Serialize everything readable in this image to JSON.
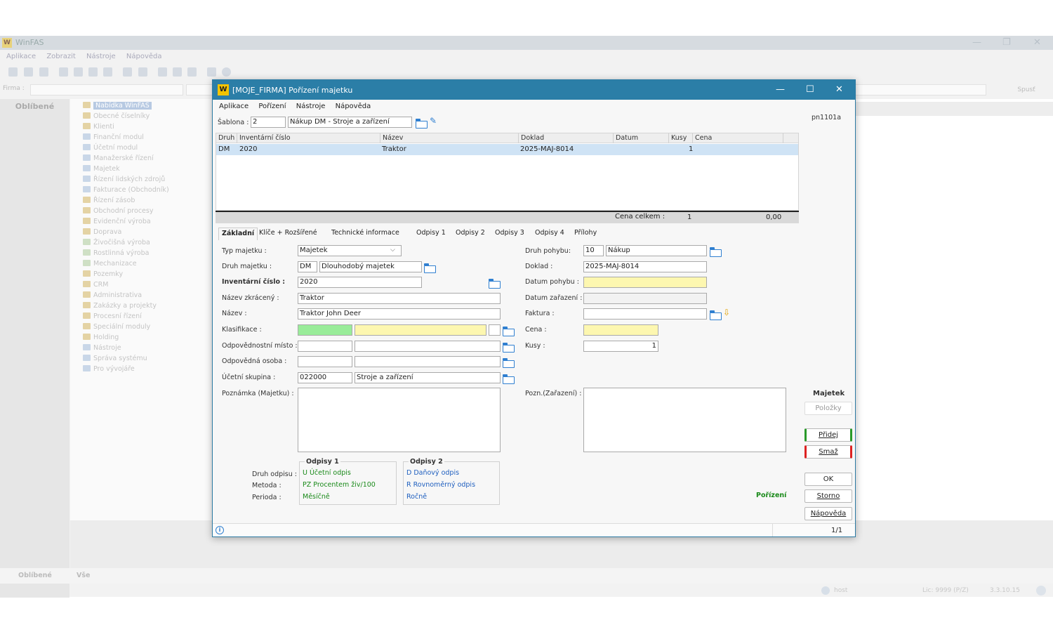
{
  "bg": {
    "title": "WinFAS",
    "menu": [
      "Aplikace",
      "Zobrazit",
      "Nástroje",
      "Nápověda"
    ],
    "firma_label": "Firma :",
    "spust": "Spusť",
    "oblibene": "Oblíbené",
    "tree_items": [
      {
        "label": "Nabídka WinFAS",
        "color": "y"
      },
      {
        "label": "Obecné číselníky",
        "color": "y"
      },
      {
        "label": "Klienti",
        "color": "y"
      },
      {
        "label": "Finanční modul",
        "color": "b"
      },
      {
        "label": "Účetní modul",
        "color": "b"
      },
      {
        "label": "Manažerské řízení",
        "color": "b"
      },
      {
        "label": "Majetek",
        "color": "b"
      },
      {
        "label": "Řízení lidských zdrojů",
        "color": "b"
      },
      {
        "label": "Fakturace (Obchodník)",
        "color": "b"
      },
      {
        "label": "Řízení zásob",
        "color": "y"
      },
      {
        "label": "Obchodní procesy",
        "color": "y"
      },
      {
        "label": "Evidenční výroba",
        "color": "y"
      },
      {
        "label": "Doprava",
        "color": "y"
      },
      {
        "label": "Živočišná výroba",
        "color": "g"
      },
      {
        "label": "Rostlinná výroba",
        "color": "g"
      },
      {
        "label": "Mechanizace",
        "color": "g"
      },
      {
        "label": "Pozemky",
        "color": "y"
      },
      {
        "label": "CRM",
        "color": "y"
      },
      {
        "label": "Administrativa",
        "color": "y"
      },
      {
        "label": "Zakázky a projekty",
        "color": "y"
      },
      {
        "label": "Procesní řízení",
        "color": "y"
      },
      {
        "label": "Speciální moduly",
        "color": "y"
      },
      {
        "label": "Holding",
        "color": "y"
      },
      {
        "label": "Nástroje",
        "color": "b"
      },
      {
        "label": "Správa systému",
        "color": "b"
      },
      {
        "label": "Pro vývojáře",
        "color": "b"
      }
    ],
    "bottom_tabs": [
      "Oblíbené",
      "Vše"
    ],
    "status": {
      "user": "host",
      "lic": "Lic: 9999 (P/Z)",
      "version": "3.3.10.15"
    }
  },
  "dialog": {
    "title": "[MOJE_FIRMA] Pořízení majetku",
    "menu": [
      "Aplikace",
      "Pořízení",
      "Nástroje",
      "Nápověda"
    ],
    "sablona_label": "Šablona :",
    "sablona_code": "2",
    "sablona_name": "Nákup DM - Stroje a zařízení",
    "side_code": "pn1101a",
    "grid": {
      "columns": [
        "Druh",
        "Inventární číslo",
        "Název",
        "Doklad",
        "Datum",
        "Kusy",
        "Cena"
      ],
      "rows": [
        [
          "DM",
          "2020",
          "Traktor",
          "2025-MAJ-8014",
          "",
          "1",
          ""
        ]
      ],
      "total_label": "Cena celkem :",
      "total_kusy": "1",
      "total_cena": "0,00"
    },
    "tabs": [
      "Základní",
      "Klíče + Rozšířené",
      "Technické informace",
      "Odpisy 1",
      "Odpisy 2",
      "Odpisy 3",
      "Odpisy 4",
      "Přílohy"
    ],
    "form": {
      "typ_label": "Typ majetku :",
      "typ_value": "Majetek",
      "druh_label": "Druh majetku :",
      "druh_code": "DM",
      "druh_name": "Dlouhodobý majetek",
      "inv_label": "Inventární číslo :",
      "inv_value": "2020",
      "nazev_zkr_label": "Název zkrácený :",
      "nazev_zkr_value": "Traktor",
      "nazev_label": "Název :",
      "nazev_value": "Traktor John Deer",
      "klas_label": "Klasifikace :",
      "odp_misto_label": "Odpovědnostní místo :",
      "odp_osoba_label": "Odpovědná osoba :",
      "ucet_label": "Účetní skupina :",
      "ucet_code": "022000",
      "ucet_name": "Stroje a zařízení",
      "pozn_label": "Poznámka (Majetku) :",
      "pohyb_label": "Druh pohybu:",
      "pohyb_code": "10",
      "pohyb_name": "Nákup",
      "doklad_label": "Doklad :",
      "doklad_value": "2025-MAJ-8014",
      "datum_pohybu_label": "Datum pohybu :",
      "datum_zar_label": "Datum zařazení :",
      "faktura_label": "Faktura :",
      "cena_label": "Cena :",
      "kusy_label": "Kusy :",
      "kusy_value": "1",
      "pozn_zar_label": "Pozn.(Zařazení) :"
    },
    "odpisy": {
      "druh_label": "Druh odpisu :",
      "metoda_label": "Metoda :",
      "perioda_label": "Perioda :",
      "o1_title": "Odpisy 1",
      "o1_druh": "U  Účetní odpis",
      "o1_metoda": "PZ  Procentem živ/100",
      "o1_perioda": "Měsíčně",
      "o2_title": "Odpisy 2",
      "o2_druh": "D  Daňový odpis",
      "o2_metoda": "R  Rovnoměrný odpis",
      "o2_perioda": "Ročně"
    },
    "mode": "Pořízení",
    "side": {
      "majetek": "Majetek",
      "polozky": "Položky",
      "pridej": "Přidej",
      "smaz": "Smaž",
      "ok": "OK",
      "storno": "Storno",
      "napoveda": "Nápověda"
    },
    "status_page": "1/1",
    "colors": {
      "title_bar": "#2b7ea7",
      "ok_green": "#1a8a1a",
      "selected_row": "#cfe3f5",
      "required_yellow": "#fdf7b0",
      "green_field": "#99ec99"
    }
  }
}
